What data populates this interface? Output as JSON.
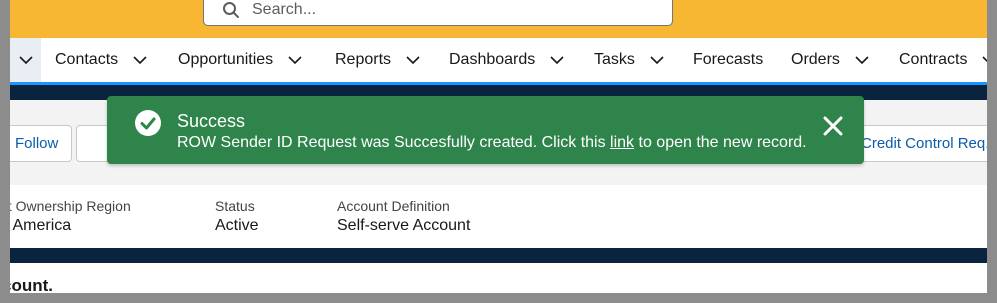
{
  "search": {
    "placeholder": "Search..."
  },
  "nav": {
    "items": [
      {
        "label": "Contacts",
        "has_menu": true
      },
      {
        "label": "Opportunities",
        "has_menu": true
      },
      {
        "label": "Reports",
        "has_menu": true
      },
      {
        "label": "Dashboards",
        "has_menu": true
      },
      {
        "label": "Tasks",
        "has_menu": true
      },
      {
        "label": "Forecasts",
        "has_menu": false
      },
      {
        "label": "Orders",
        "has_menu": true
      },
      {
        "label": "Contracts",
        "has_menu": true
      }
    ]
  },
  "actions": {
    "follow_label": "Follow",
    "credit_control_label": "Credit Control Req."
  },
  "highlights": {
    "fields": [
      {
        "label": "nt Ownership Region",
        "value": "n America"
      },
      {
        "label": "Status",
        "value": "Active"
      },
      {
        "label": "Account Definition",
        "value": "Self-serve Account"
      }
    ]
  },
  "bottom": {
    "text": "count."
  },
  "toast": {
    "title": "Success",
    "message_before": "ROW Sender ID Request was Succesfully created. Click this ",
    "link_text": "link",
    "message_after": " to open the new record.",
    "icon": "success-check-icon",
    "close_icon": "close-icon",
    "color": "#2e844a"
  },
  "colors": {
    "header": "#f7b733",
    "nav_active_underline": "#1b96ff",
    "dark_band": "#0a2440",
    "link": "#0b5cab"
  }
}
